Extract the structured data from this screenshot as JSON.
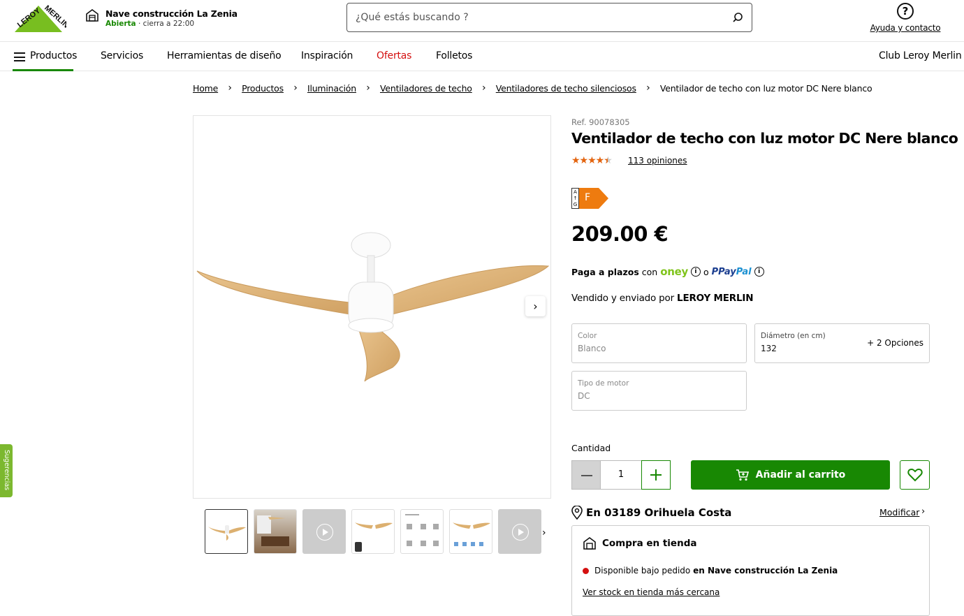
{
  "brand": {
    "name": "LEROY MERLIN",
    "color": "#78be20",
    "accent_green": "#188803"
  },
  "store": {
    "name": "Nave construcción La Zenia",
    "status": "Abierta",
    "closing": " · cierra a 22:00"
  },
  "search": {
    "placeholder": "¿Qué estás buscando ?"
  },
  "help": {
    "label": "Ayuda y contacto"
  },
  "nav": {
    "products": "Productos",
    "services": "Servicios",
    "design_tools": "Herramientas de diseño",
    "inspiration": "Inspiración",
    "offers": "Ofertas",
    "brochures": "Folletos",
    "club": "Club Leroy Merlin"
  },
  "breadcrumb": {
    "items": [
      "Home",
      "Productos",
      "Iluminación",
      "Ventiladores de techo",
      "Ventiladores de techo silenciosos"
    ],
    "current": "Ventilador de techo con luz motor DC Nere blanco"
  },
  "sidetab": {
    "label": "Sugerencias"
  },
  "product": {
    "ref": "Ref. 90078305",
    "title": "Ventilador de techo con luz motor DC Nere blanco",
    "rating": 4.5,
    "reviews": "113 opiniones",
    "energy": {
      "scale_top": "A",
      "scale_bottom": "G",
      "class": "F",
      "color": "#ee7b0f"
    },
    "price": "209.00 €",
    "installments": {
      "label": "Paga a plazos",
      "with": "con",
      "oney": "oney",
      "or": "o",
      "paypal_a": "Pay",
      "paypal_b": "Pal"
    },
    "seller": {
      "prefix": "Vendido y enviado por",
      "name": "LEROY MERLIN"
    },
    "options": {
      "color": {
        "label": "Color",
        "value": "Blanco"
      },
      "diameter": {
        "label": "Diámetro (en cm)",
        "value": "132",
        "more": "+ 2 Opciones"
      },
      "motor": {
        "label": "Tipo de motor",
        "value": "DC"
      }
    },
    "quantity": {
      "label": "Cantidad",
      "value": "1"
    },
    "add_to_cart": "Añadir al carrito"
  },
  "delivery": {
    "location": "En 03189 Orihuela Costa",
    "modify": "Modificar",
    "store_purchase": "Compra en tienda",
    "availability_prefix": "Disponible bajo pedido",
    "availability_in": "en Nave construcción La Zenia",
    "nearest": "Ver stock en tienda más cercana"
  }
}
